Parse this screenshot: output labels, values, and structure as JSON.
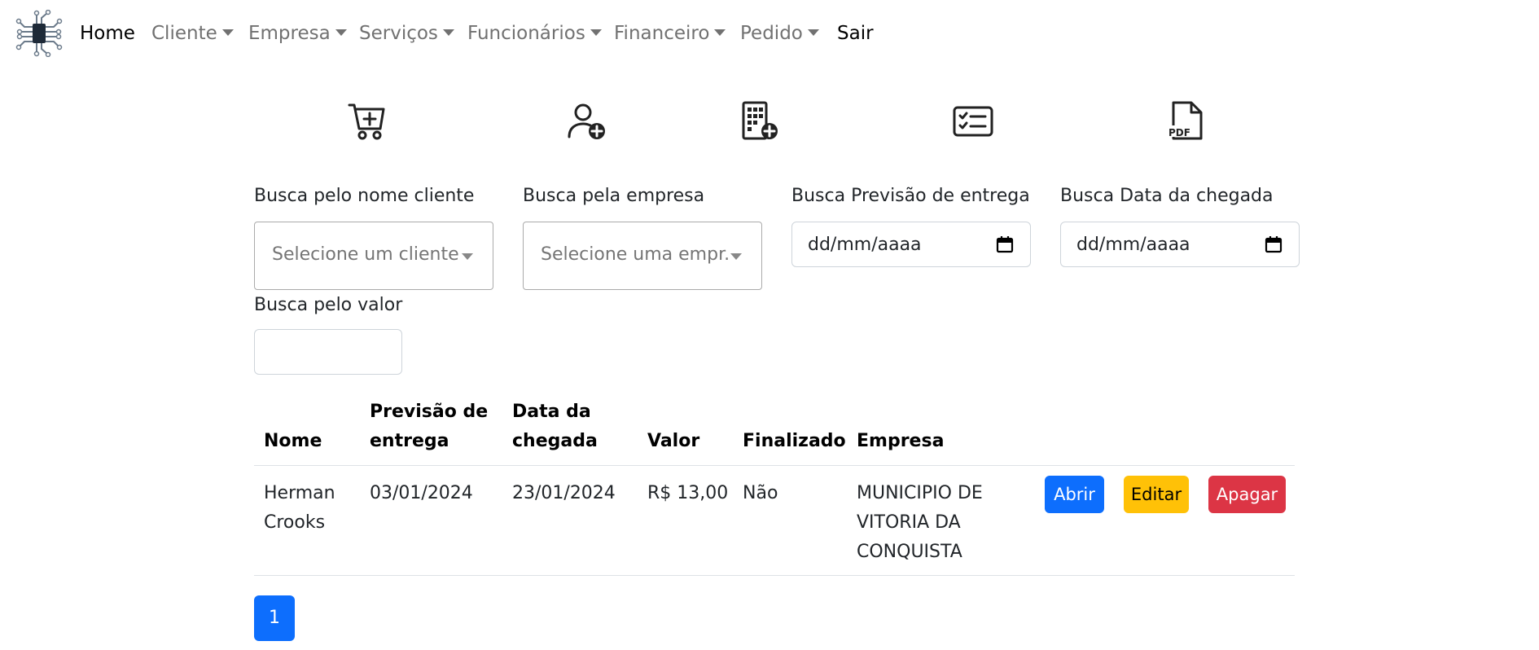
{
  "nav": {
    "logo_icon": "circuit-chip-logo",
    "home": "Home",
    "cliente": "Cliente",
    "empresa": "Empresa",
    "servicos": "Serviços",
    "funcionarios": "Funcionários",
    "financeiro": "Financeiro",
    "pedido": "Pedido",
    "sair": "Sair"
  },
  "actions": {
    "icons": [
      "cart-plus-icon",
      "person-add-icon",
      "building-add-icon",
      "card-checklist-icon",
      "pdf-file-icon"
    ]
  },
  "filters": {
    "cliente_label": "Busca pelo nome cliente",
    "cliente_placeholder": "Selecione um cliente",
    "empresa_label": "Busca pela empresa",
    "empresa_placeholder": "Selecione uma empr...",
    "previsao_label": "Busca Previsão de entrega",
    "previsao_value": "dd/mm/aaaa",
    "chegada_label": "Busca Data da chegada",
    "chegada_value": "dd/mm/aaaa",
    "valor_label": "Busca pelo valor",
    "valor_value": ""
  },
  "table": {
    "headers": {
      "nome": "Nome",
      "previsao_1": "Previsão de",
      "previsao_2": "entrega",
      "chegada_1": "Data da",
      "chegada_2": "chegada",
      "valor": "Valor",
      "finalizado": "Finalizado",
      "empresa": "Empresa"
    },
    "rows": [
      {
        "nome_1": "Herman",
        "nome_2": "Crooks",
        "previsao": "03/01/2024",
        "chegada": "23/01/2024",
        "valor": "R$ 13,00",
        "finalizado": "Não",
        "empresa_1": "MUNICIPIO DE",
        "empresa_2": "VITORIA DA",
        "empresa_3": "CONQUISTA",
        "abrir": "Abrir",
        "editar": "Editar",
        "apagar": "Apagar"
      }
    ]
  },
  "pagination": {
    "current": "1"
  },
  "colors": {
    "primary": "#0d6efd",
    "warning": "#ffc107",
    "danger": "#dc3545"
  }
}
